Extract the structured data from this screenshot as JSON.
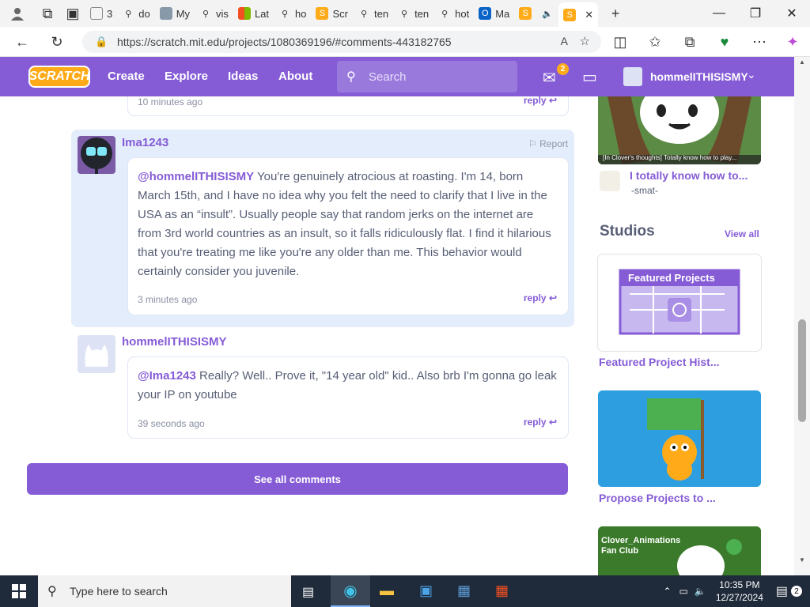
{
  "browser": {
    "tabs": [
      {
        "label": "3",
        "icon": "page-icon"
      },
      {
        "label": "do",
        "icon": "search-icon"
      },
      {
        "label": "My",
        "icon": "image-icon"
      },
      {
        "label": "vis",
        "icon": "search-icon"
      },
      {
        "label": "Lat",
        "icon": "windows-icon"
      },
      {
        "label": "ho",
        "icon": "search-icon"
      },
      {
        "label": "Scr",
        "icon": "scratch-icon"
      },
      {
        "label": "ten",
        "icon": "search-icon"
      },
      {
        "label": "ten",
        "icon": "search-icon"
      },
      {
        "label": "hot",
        "icon": "search-icon"
      },
      {
        "label": "Ma",
        "icon": "outlook-icon"
      }
    ],
    "url": "https://scratch.mit.edu/projects/1080369196/#comments-443182765"
  },
  "scratch_nav": {
    "logo": "SCRATCH",
    "links": [
      "Create",
      "Explore",
      "Ideas",
      "About"
    ],
    "search_placeholder": "Search",
    "message_count": "2",
    "username": "hommelITHISISMY"
  },
  "comments": {
    "prev_time": "10 minutes ago",
    "prev_reply": "reply",
    "c1": {
      "user": "Ima1243",
      "report": "Report",
      "mention": "@hommelITHISISMY",
      "text": " You're genuinely atrocious at roasting. I'm 14, born March 15th, and I have no idea why you felt the need to clarify that I live in the USA as an “insult”. Usually people say that random jerks on the internet are from 3rd world countries as an insult, so it falls ridiculously flat. I find it hilarious that you're treating me like you're any older than me. This behavior would certainly consider you juvenile.",
      "time": "3 minutes ago",
      "reply": "reply"
    },
    "c2": {
      "user": "hommelITHISISMY",
      "mention": "@Ima1243",
      "text": " Really? Well.. Prove it, \"14 year old\" kid.. Also brb I'm gonna go leak your IP on youtube",
      "time": "39 seconds ago",
      "reply": "reply"
    },
    "see_all": "See all comments"
  },
  "sidebar": {
    "remix_caption": "[In Clover's thoughts] Totally know how to play...",
    "remix_title": "I totally know how to...",
    "remix_author": "-smat-",
    "studios_title": "Studios",
    "view_all": "View all",
    "studios": [
      {
        "title": "Featured Project Hist...",
        "thumb_text": "Featured Projects"
      },
      {
        "title": "Propose Projects to ..."
      },
      {
        "title": "",
        "thumb_text": "Clover_Animations Fan Club"
      }
    ]
  },
  "taskbar": {
    "search_placeholder": "Type here to search",
    "time": "10:35 PM",
    "date": "12/27/2024",
    "notif_count": "2"
  }
}
